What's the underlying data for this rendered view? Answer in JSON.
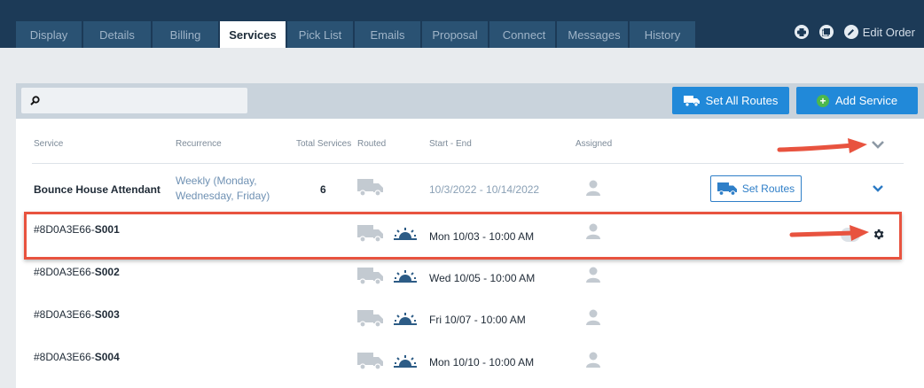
{
  "tabs": [
    {
      "label": "Display",
      "active": false
    },
    {
      "label": "Details",
      "active": false
    },
    {
      "label": "Billing",
      "active": false
    },
    {
      "label": "Services",
      "active": true
    },
    {
      "label": "Pick List",
      "active": false
    },
    {
      "label": "Emails",
      "active": false
    },
    {
      "label": "Proposal",
      "active": false
    },
    {
      "label": "Connect",
      "active": false,
      "icon": "connect-icon"
    },
    {
      "label": "Messages",
      "active": false,
      "icon": "inbox-icon"
    },
    {
      "label": "History",
      "active": false
    }
  ],
  "header_actions": {
    "print_icon": "print-icon",
    "copy_icon": "copy-icon",
    "edit_label": "Edit Order"
  },
  "toolbar": {
    "search_placeholder": "",
    "set_all_routes": "Set All Routes",
    "add_service": "Add Service"
  },
  "columns": {
    "service": "Service",
    "recurrence": "Recurrence",
    "total": "Total Services",
    "routed": "Routed",
    "start_end": "Start - End",
    "assigned": "Assigned"
  },
  "service": {
    "name": "Bounce House Attendant",
    "recurrence": "Weekly (Monday, Wednesday, Friday)",
    "total": "6",
    "range": "10/3/2022 - 10/14/2022",
    "set_routes": "Set Routes"
  },
  "occurrences": [
    {
      "prefix": "#8D0A3E66-",
      "code": "S001",
      "date": "Mon 10/03 - 10:00 AM"
    },
    {
      "prefix": "#8D0A3E66-",
      "code": "S002",
      "date": "Wed 10/05 - 10:00 AM"
    },
    {
      "prefix": "#8D0A3E66-",
      "code": "S003",
      "date": "Fri 10/07 - 10:00 AM"
    },
    {
      "prefix": "#8D0A3E66-",
      "code": "S004",
      "date": "Mon 10/10 - 10:00 AM"
    }
  ],
  "colors": {
    "topbar": "#1c3a57",
    "accent": "#2189d9",
    "annotation": "#e8533f"
  }
}
